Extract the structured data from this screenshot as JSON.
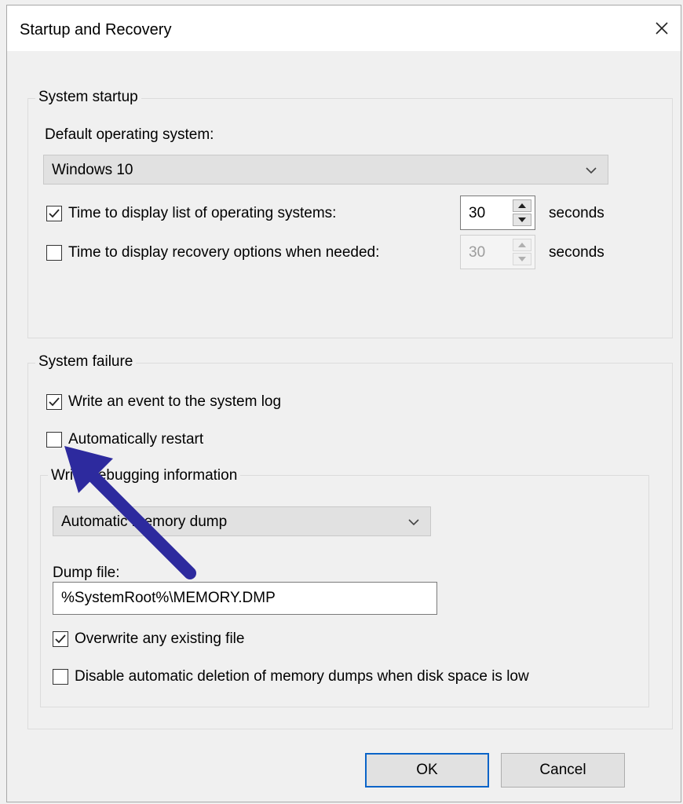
{
  "window": {
    "title": "Startup and Recovery"
  },
  "system_startup": {
    "legend": "System startup",
    "default_os_label": "Default operating system:",
    "default_os_value": "Windows 10",
    "display_list": {
      "label": "Time to display list of operating systems:",
      "checked": true,
      "value": "30",
      "unit": "seconds"
    },
    "display_recovery": {
      "label": "Time to display recovery options when needed:",
      "checked": false,
      "value": "30",
      "unit": "seconds",
      "enabled": false
    }
  },
  "system_failure": {
    "legend": "System failure",
    "write_event": {
      "label": "Write an event to the system log",
      "checked": true
    },
    "auto_restart": {
      "label": "Automatically restart",
      "checked": false
    },
    "debug": {
      "legend": "Write debugging information",
      "dump_type": "Automatic memory dump",
      "dump_file_label": "Dump file:",
      "dump_file_value": "%SystemRoot%\\MEMORY.DMP",
      "overwrite": {
        "label": "Overwrite any existing file",
        "checked": true
      },
      "disable_deletion": {
        "label": "Disable automatic deletion of memory dumps when disk space is low",
        "checked": false
      }
    }
  },
  "buttons": {
    "ok": "OK",
    "cancel": "Cancel"
  },
  "annotation": {
    "arrow_color": "#2d2a9e"
  },
  "icons": {
    "close": "close-icon",
    "chevron": "chevron-down-icon",
    "check": "check-icon",
    "spin_up": "spin-up-icon",
    "spin_down": "spin-down-icon"
  }
}
